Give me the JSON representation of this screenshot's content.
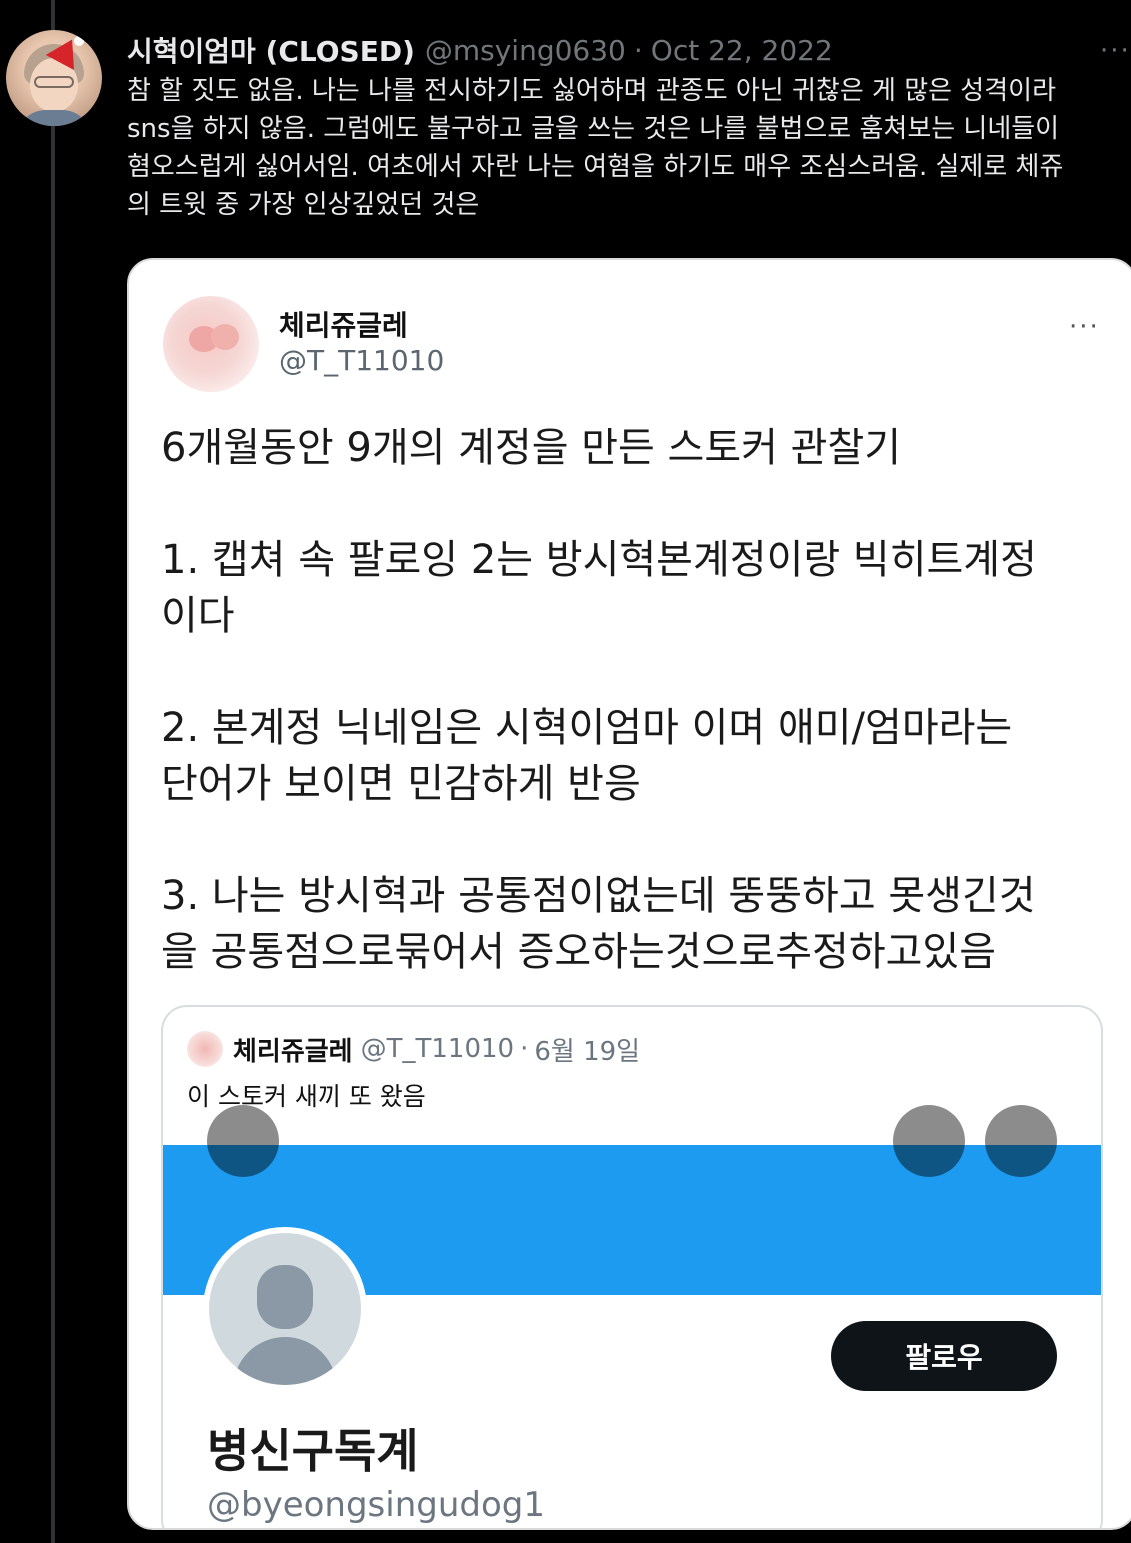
{
  "tweet": {
    "display_name": "시혁이엄마 (CLOSED)",
    "handle": "@msying0630",
    "separator": "·",
    "date": "Oct 22, 2022",
    "more": "···",
    "text_lines": [
      "참 할 짓도 없음. 나는 나를 전시하기도 싫어하며 관종도 아닌 귀찮은 게 많은 성격이라",
      "sns을 하지 않음. 그럼에도 불구하고 글을 쓰는 것은 나를 불법으로 훔쳐보는 니네들이",
      "혐오스럽게 싫어서임. 여초에서 자란 나는 여혐을 하기도 매우 조심스러움. 실제로 체쥬",
      "의 트윗 중 가장 인상깊었던 것은"
    ]
  },
  "embedded": {
    "display_name": "체리쥬글레",
    "handle": "@T_T11010",
    "more": "···",
    "body": {
      "line1": "6개월동안 9개의 계정을 만든 스토커 관찰기",
      "item1_a": "1. 캡쳐 속 팔로잉 2는 방시혁본계정이랑 빅히트계정",
      "item1_b": "이다",
      "item2_a": "2. 본계정 닉네임은 시혁이엄마 이며 애미/엄마라는",
      "item2_b": "단어가 보이면 민감하게 반응",
      "item3_a": "3. 나는 방시혁과 공통점이없는데 뚱뚱하고 못생긴것",
      "item3_b": "을 공통점으로묶어서 증오하는것으로추정하고있음"
    },
    "quote": {
      "display_name": "체리쥬글레",
      "handle": "@T_T11010",
      "separator": "·",
      "date": "6월 19일",
      "text": "이 스토커 새끼 또 왔음",
      "profile": {
        "follow_label": "팔로우",
        "name": "병신구독계",
        "handle": "@byeongsingudog1"
      }
    }
  },
  "colors": {
    "background": "#000000",
    "banner": "#1d9bf0",
    "secondary_text": "#71767b"
  }
}
